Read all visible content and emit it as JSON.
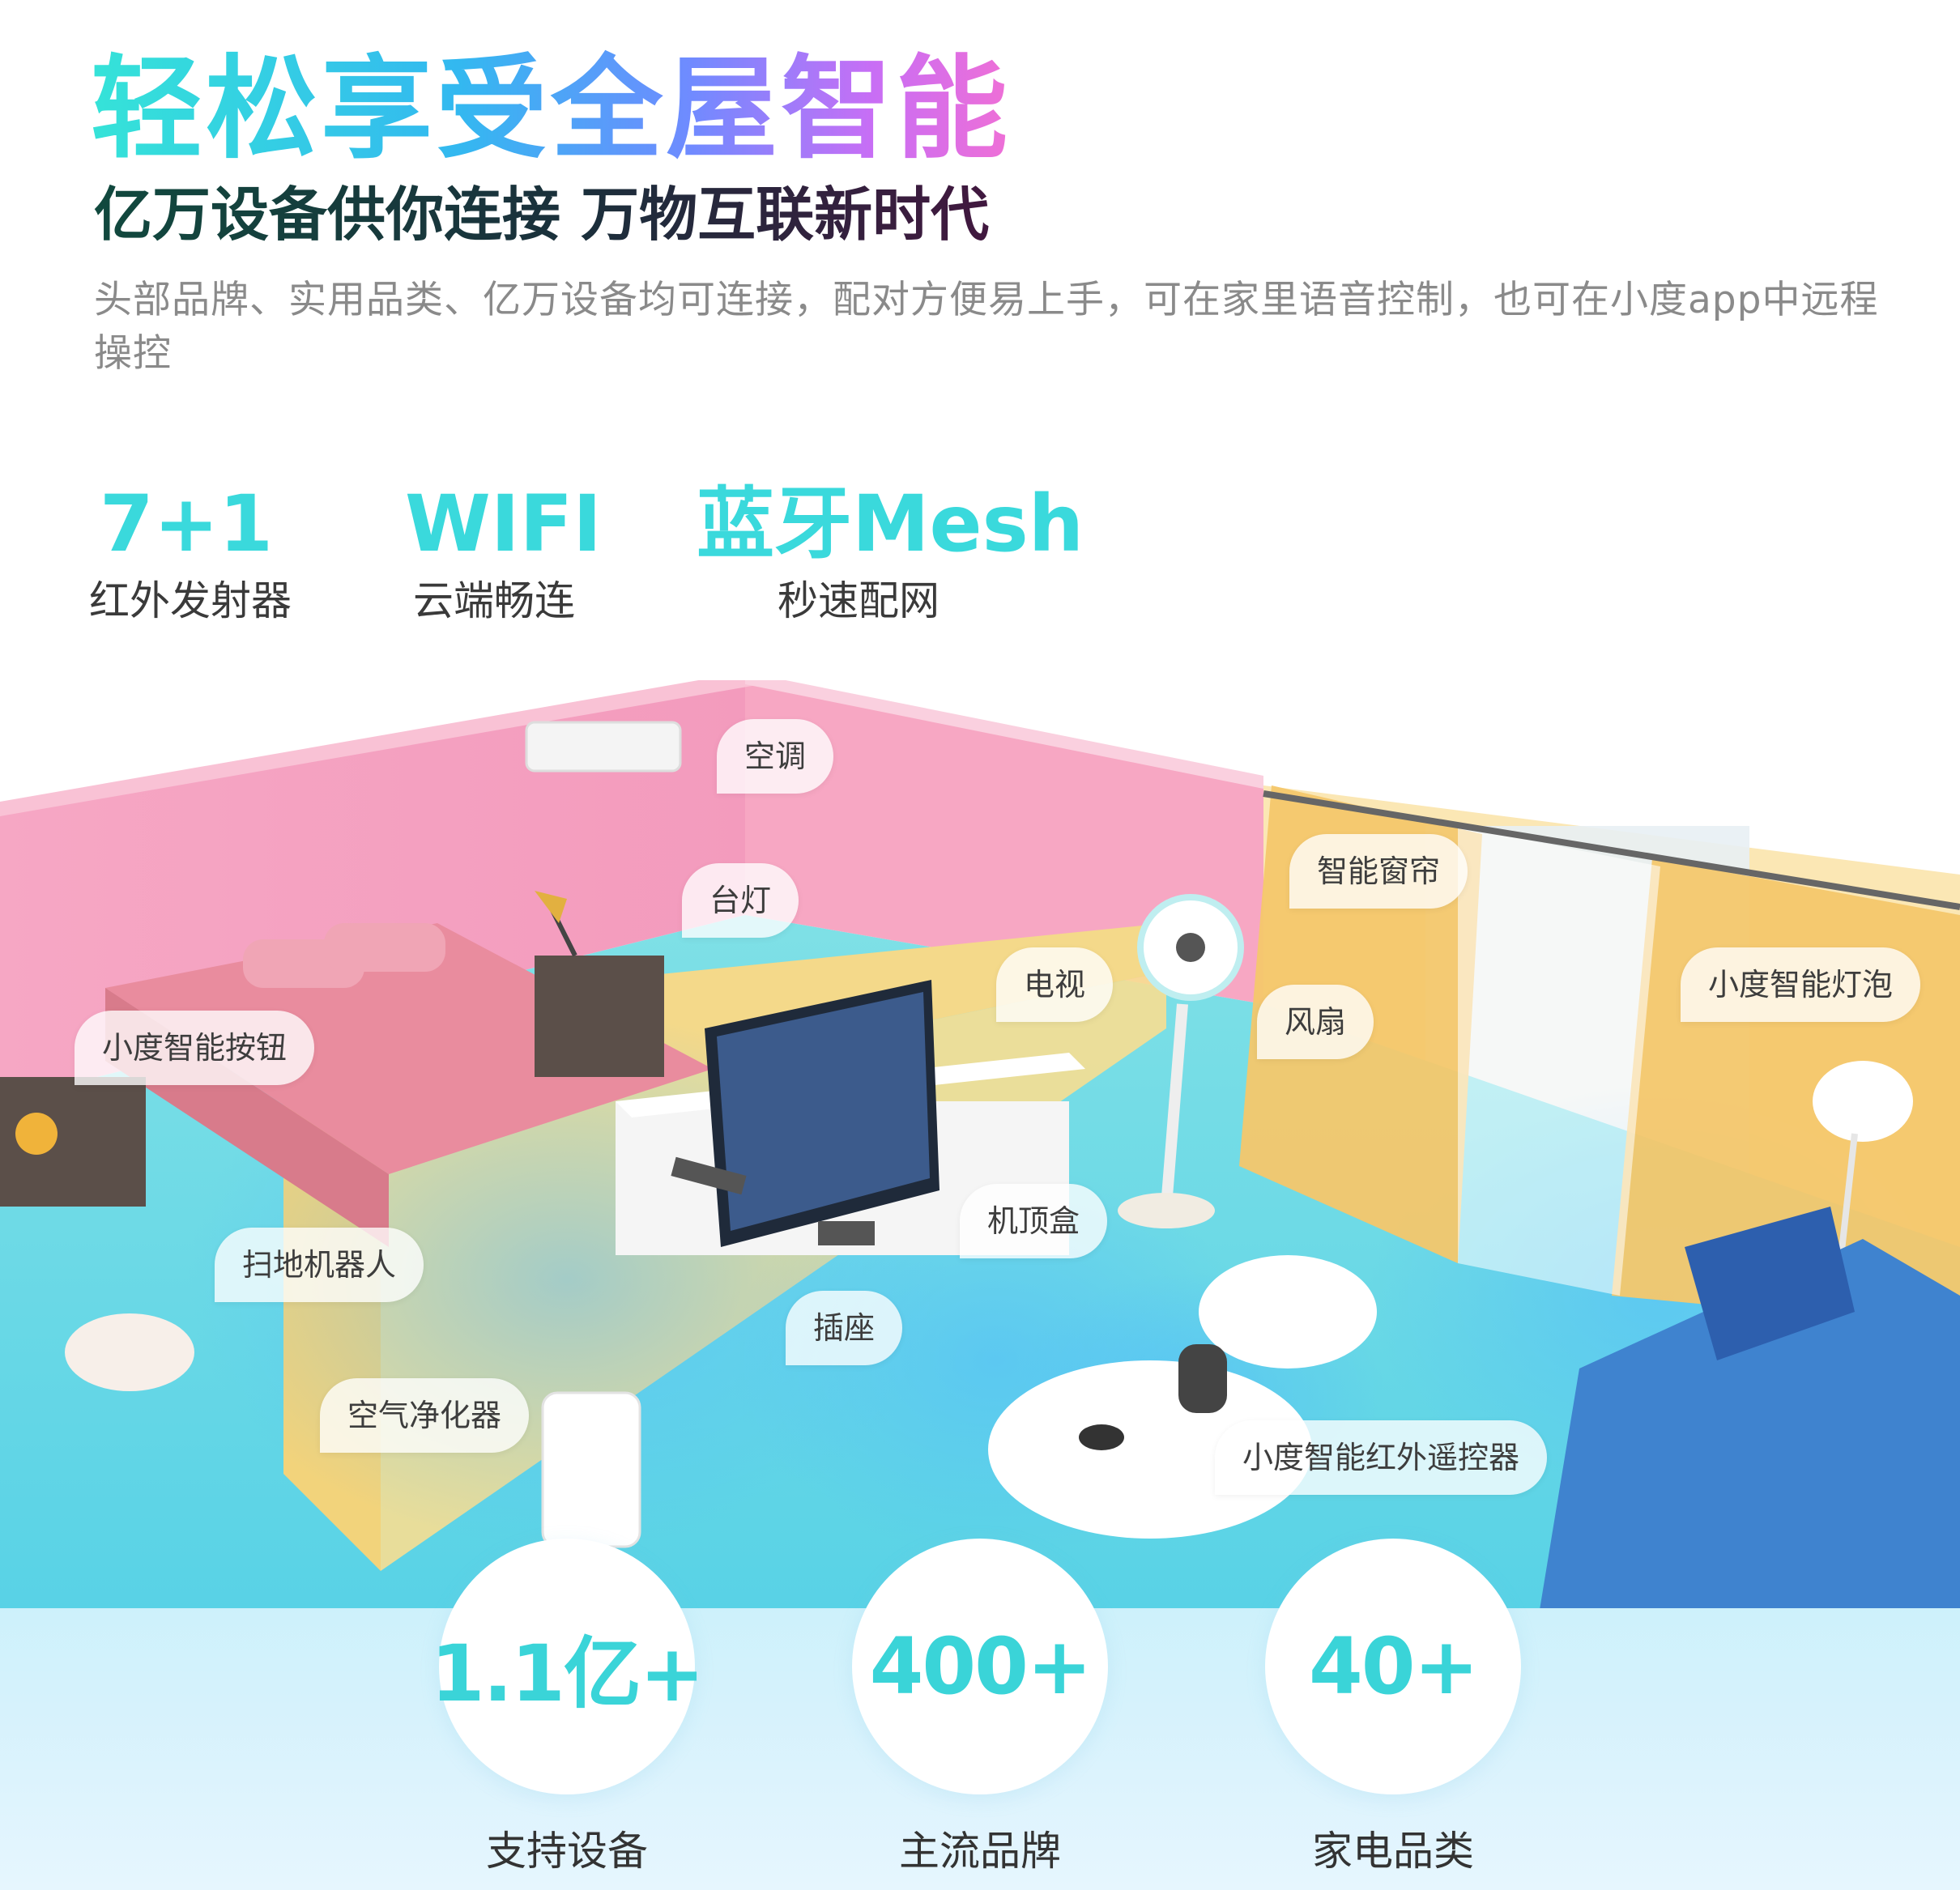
{
  "header": {
    "title": "轻松享受全屋智能",
    "subtitle": "亿万设备供你连接  万物互联新时代",
    "description": "头部品牌、实用品类、亿万设备均可连接，配对方便易上手，可在家里语音控制，也可在小度app中远程操控"
  },
  "features": [
    {
      "value": "7+1",
      "label": "红外发射器"
    },
    {
      "value": "WIFI",
      "label": "云端畅连"
    },
    {
      "value": "蓝牙Mesh",
      "label": "秒速配网"
    }
  ],
  "callouts": {
    "ac": "空调",
    "desk_lamp": "台灯",
    "curtain": "智能窗帘",
    "tv": "电视",
    "fan": "风扇",
    "bulb": "小度智能灯泡",
    "button": "小度智能按钮",
    "set_top_box": "机顶盒",
    "robot_vacuum": "扫地机器人",
    "socket": "插座",
    "air_purifier": "空气净化器",
    "ir_remote": "小度智能红外遥控器"
  },
  "stats": [
    {
      "value": "1.1亿+",
      "label": "支持设备"
    },
    {
      "value": "400+",
      "label": "主流品牌"
    },
    {
      "value": "40+",
      "label": "家电品类"
    }
  ],
  "colors": {
    "accent": "#3ad9dc",
    "wall_pink": "#f5a3bf",
    "wall_yellow": "#f7d98a",
    "floor": "#72dde6",
    "curtain": "#f4c76b",
    "sofa": "#3f83cf"
  }
}
